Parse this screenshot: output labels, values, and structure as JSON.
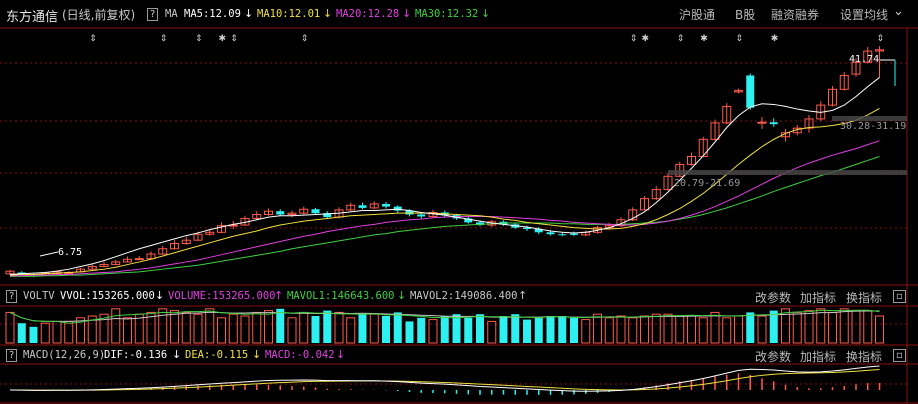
{
  "header": {
    "stock_name": "东方通信",
    "period": "(日线,前复权)",
    "q": "?",
    "ma_label": "MA",
    "ma5": "MA5:12.09",
    "ma10": "MA10:12.01",
    "ma20": "MA20:12.28",
    "ma30": "MA30:12.32",
    "arrow_down": "↓",
    "links": [
      "沪股通",
      "B股",
      "融资融券",
      "设置均线"
    ],
    "collapse": "⌄"
  },
  "price_annotations": {
    "high_label": "41.74",
    "low_label": "6.75",
    "range_upper": "30.28-31.19",
    "range_lower": "20.79-21.69"
  },
  "volume_header": {
    "q": "?",
    "name": "VOLTV",
    "vvol": "VVOL:153265.000",
    "volume": "VOLUME:153265.000",
    "mavol1": "MAVOL1:146643.600",
    "mavol2": "MAVOL2:149086.400",
    "arrow_down": "↓",
    "arrow_up": "↑",
    "links": [
      "改参数",
      "加指标",
      "换指标"
    ]
  },
  "macd_header": {
    "q": "?",
    "name": "MACD(12,26,9)",
    "dif": "DIF:-0.136",
    "dea": "DEA:-0.115",
    "macd": "MACD:-0.042",
    "arrow_down": "↓",
    "links": [
      "改参数",
      "加指标",
      "换指标"
    ]
  },
  "colors": {
    "up": "#ff5a4a",
    "down": "#2ff0f0",
    "ma5": "#ffffff",
    "ma10": "#f0e040",
    "ma20": "#e040e0",
    "ma30": "#40d040",
    "grid": "#8a1010"
  },
  "chart_data": {
    "type": "candlestick",
    "y_range": [
      5.5,
      44.5
    ],
    "candles": [
      [
        7.2,
        7.6,
        7.0,
        7.8
      ],
      [
        7.4,
        7.2,
        7.0,
        7.6
      ],
      [
        7.1,
        7.0,
        6.75,
        7.3
      ],
      [
        7.0,
        7.3,
        6.9,
        7.5
      ],
      [
        7.2,
        7.5,
        7.1,
        7.7
      ],
      [
        7.3,
        7.4,
        7.1,
        7.6
      ],
      [
        7.5,
        7.9,
        7.4,
        8.1
      ],
      [
        7.9,
        8.3,
        7.8,
        8.6
      ],
      [
        8.3,
        8.6,
        8.2,
        9.0
      ],
      [
        8.6,
        9.0,
        8.5,
        9.3
      ],
      [
        9.0,
        9.4,
        8.9,
        9.8
      ],
      [
        9.4,
        9.5,
        9.3,
        9.9
      ],
      [
        9.5,
        10.2,
        9.4,
        10.6
      ],
      [
        10.2,
        11.0,
        10.1,
        11.4
      ],
      [
        11.0,
        11.8,
        10.9,
        12.3
      ],
      [
        11.8,
        12.3,
        11.6,
        12.8
      ],
      [
        12.3,
        13.2,
        12.2,
        13.6
      ],
      [
        13.2,
        13.5,
        13.0,
        13.9
      ],
      [
        13.5,
        14.5,
        13.4,
        15.0
      ],
      [
        14.5,
        14.6,
        14.0,
        15.2
      ],
      [
        14.6,
        15.6,
        14.5,
        16.0
      ],
      [
        15.6,
        16.2,
        15.4,
        16.7
      ],
      [
        16.2,
        16.7,
        16.0,
        17.1
      ],
      [
        16.7,
        16.2,
        16.0,
        17.0
      ],
      [
        16.2,
        16.4,
        15.8,
        16.8
      ],
      [
        16.4,
        17.0,
        16.2,
        17.4
      ],
      [
        17.0,
        16.4,
        16.2,
        17.2
      ],
      [
        16.4,
        15.8,
        15.5,
        16.7
      ],
      [
        15.8,
        16.9,
        15.6,
        17.3
      ],
      [
        16.9,
        17.6,
        16.7,
        18.0
      ],
      [
        17.6,
        17.2,
        17.0,
        18.0
      ],
      [
        17.2,
        17.8,
        17.0,
        18.2
      ],
      [
        17.8,
        17.4,
        17.1,
        18.1
      ],
      [
        17.4,
        16.8,
        16.5,
        17.6
      ],
      [
        16.8,
        16.2,
        15.9,
        17.0
      ],
      [
        16.2,
        15.9,
        15.6,
        16.5
      ],
      [
        15.9,
        16.5,
        15.7,
        16.9
      ],
      [
        16.5,
        16.1,
        15.8,
        16.8
      ],
      [
        16.1,
        15.6,
        15.4,
        16.3
      ],
      [
        15.6,
        15.0,
        14.8,
        15.9
      ],
      [
        15.0,
        14.6,
        14.4,
        15.3
      ],
      [
        14.6,
        15.1,
        14.3,
        15.4
      ],
      [
        15.1,
        14.7,
        14.5,
        15.3
      ],
      [
        14.7,
        14.2,
        14.0,
        15.0
      ],
      [
        14.2,
        14.0,
        13.7,
        14.5
      ],
      [
        14.0,
        13.5,
        13.2,
        14.3
      ],
      [
        13.5,
        13.2,
        13.0,
        13.8
      ],
      [
        13.2,
        13.1,
        12.9,
        13.5
      ],
      [
        13.3,
        13.1,
        12.9,
        13.6
      ],
      [
        13.1,
        13.5,
        12.9,
        13.8
      ],
      [
        13.5,
        14.2,
        13.3,
        14.5
      ],
      [
        14.2,
        14.5,
        14.0,
        14.9
      ],
      [
        14.5,
        15.4,
        14.3,
        15.8
      ],
      [
        15.4,
        16.9,
        15.2,
        17.3
      ],
      [
        16.9,
        18.6,
        16.8,
        19.0
      ],
      [
        18.6,
        20.0,
        18.4,
        20.5
      ],
      [
        20.0,
        22.0,
        19.8,
        22.5
      ],
      [
        22.0,
        23.8,
        21.9,
        24.2
      ],
      [
        23.8,
        25.0,
        23.6,
        25.6
      ],
      [
        25.0,
        27.6,
        24.9,
        28.0
      ],
      [
        27.6,
        30.1,
        27.4,
        30.6
      ],
      [
        30.1,
        32.6,
        29.9,
        33.1
      ],
      [
        34.8,
        35.0,
        34.6,
        35.3
      ],
      [
        37.3,
        32.4,
        32.1,
        37.6
      ],
      [
        30.1,
        30.2,
        29.2,
        31.0
      ],
      [
        30.2,
        29.9,
        29.5,
        30.8
      ],
      [
        28.0,
        28.6,
        27.3,
        29.2
      ],
      [
        28.6,
        29.3,
        28.2,
        29.8
      ],
      [
        29.3,
        30.7,
        28.6,
        31.3
      ],
      [
        30.7,
        32.8,
        30.4,
        33.4
      ],
      [
        32.8,
        35.2,
        32.6,
        35.7
      ],
      [
        35.2,
        37.3,
        35.0,
        37.8
      ],
      [
        37.5,
        39.3,
        37.1,
        39.9
      ],
      [
        39.3,
        41.0,
        39.1,
        41.6
      ],
      [
        41.0,
        41.2,
        37.0,
        41.74
      ]
    ],
    "volumes": [
      0.85,
      0.55,
      0.45,
      0.55,
      0.6,
      0.6,
      0.7,
      0.75,
      0.8,
      0.95,
      0.7,
      0.8,
      0.85,
      0.95,
      0.9,
      0.85,
      0.8,
      0.95,
      0.7,
      0.8,
      0.75,
      0.85,
      0.9,
      0.95,
      0.7,
      0.85,
      0.75,
      0.9,
      0.85,
      0.7,
      0.8,
      0.8,
      0.75,
      0.85,
      0.6,
      0.7,
      0.65,
      0.75,
      0.8,
      0.7,
      0.8,
      0.6,
      0.75,
      0.8,
      0.65,
      0.7,
      0.75,
      0.75,
      0.7,
      0.65,
      0.8,
      0.7,
      0.75,
      0.7,
      0.75,
      0.8,
      0.8,
      0.75,
      0.75,
      0.7,
      0.85,
      0.7,
      0.75,
      0.85,
      0.75,
      0.9,
      0.95,
      0.85,
      0.9,
      0.95,
      0.85,
      0.95,
      0.9,
      0.9,
      0.75
    ],
    "ma5": [
      7.1,
      7.2,
      7.3,
      7.4,
      7.6,
      7.9,
      8.3,
      8.7,
      9.2,
      9.8,
      10.4,
      11.0,
      11.5,
      12.0,
      12.5,
      13.0,
      13.4,
      13.9,
      14.3,
      14.7,
      15.0,
      15.4,
      15.8,
      16.0,
      16.0,
      16.1,
      16.2,
      16.3,
      16.4,
      16.6,
      16.8,
      16.8,
      16.9,
      17.0,
      16.8,
      16.5,
      16.3,
      16.1,
      15.8,
      15.5,
      15.2,
      14.9,
      14.7,
      14.5,
      14.3,
      14.0,
      13.7,
      13.5,
      13.4,
      13.5,
      13.8,
      14.2,
      14.8,
      15.6,
      16.6,
      18.0,
      19.6,
      21.4,
      23.2,
      25.1,
      27.2,
      29.4,
      31.2,
      32.5,
      33.0,
      32.9,
      32.6,
      32.2,
      31.9,
      31.7,
      32.0,
      32.8,
      34.1,
      35.6,
      37.0
    ],
    "ma10": [
      7.0,
      7.1,
      7.1,
      7.2,
      7.3,
      7.4,
      7.5,
      7.7,
      7.9,
      8.2,
      8.6,
      9.0,
      9.4,
      9.9,
      10.4,
      10.9,
      11.4,
      11.9,
      12.4,
      12.9,
      13.3,
      13.7,
      14.2,
      14.6,
      14.9,
      15.2,
      15.4,
      15.6,
      15.8,
      16.0,
      16.1,
      16.2,
      16.3,
      16.4,
      16.4,
      16.4,
      16.4,
      16.3,
      16.2,
      16.1,
      16.0,
      15.8,
      15.5,
      15.3,
      15.0,
      14.8,
      14.6,
      14.4,
      14.2,
      14.1,
      14.0,
      14.0,
      14.1,
      14.4,
      14.8,
      15.4,
      16.2,
      17.1,
      18.2,
      19.4,
      20.8,
      22.3,
      23.8,
      25.2,
      26.5,
      27.6,
      28.5,
      29.1,
      29.4,
      29.5,
      29.7,
      30.0,
      30.5,
      31.3,
      32.3
    ],
    "ma20": [
      6.9,
      6.9,
      7.0,
      7.0,
      7.1,
      7.1,
      7.2,
      7.3,
      7.4,
      7.5,
      7.7,
      7.9,
      8.1,
      8.4,
      8.7,
      9.0,
      9.3,
      9.7,
      10.1,
      10.5,
      10.9,
      11.3,
      11.7,
      12.1,
      12.5,
      12.9,
      13.2,
      13.6,
      13.9,
      14.2,
      14.5,
      14.7,
      15.0,
      15.2,
      15.4,
      15.5,
      15.7,
      15.8,
      15.9,
      15.9,
      15.9,
      15.9,
      15.8,
      15.7,
      15.6,
      15.5,
      15.3,
      15.2,
      15.0,
      14.9,
      14.8,
      14.7,
      14.6,
      14.6,
      14.7,
      14.9,
      15.2,
      15.6,
      16.1,
      16.7,
      17.4,
      18.2,
      19.0,
      19.9,
      20.8,
      21.7,
      22.5,
      23.3,
      24.0,
      24.6,
      25.2,
      25.7,
      26.2,
      26.8,
      27.4
    ],
    "ma30": [
      6.8,
      6.8,
      6.8,
      6.9,
      6.9,
      7.0,
      7.0,
      7.1,
      7.2,
      7.3,
      7.4,
      7.5,
      7.7,
      7.9,
      8.1,
      8.3,
      8.5,
      8.8,
      9.1,
      9.4,
      9.7,
      10.0,
      10.3,
      10.6,
      11.0,
      11.3,
      11.6,
      11.9,
      12.2,
      12.5,
      12.8,
      13.1,
      13.3,
      13.6,
      13.8,
      14.0,
      14.2,
      14.4,
      14.5,
      14.6,
      14.7,
      14.8,
      14.9,
      14.9,
      14.9,
      14.9,
      14.9,
      14.8,
      14.8,
      14.7,
      14.7,
      14.7,
      14.7,
      14.8,
      14.9,
      15.0,
      15.2,
      15.5,
      15.8,
      16.2,
      16.7,
      17.2,
      17.8,
      18.4,
      19.0,
      19.7,
      20.3,
      20.9,
      21.5,
      22.1,
      22.6,
      23.2,
      23.8,
      24.4,
      25.0
    ]
  }
}
